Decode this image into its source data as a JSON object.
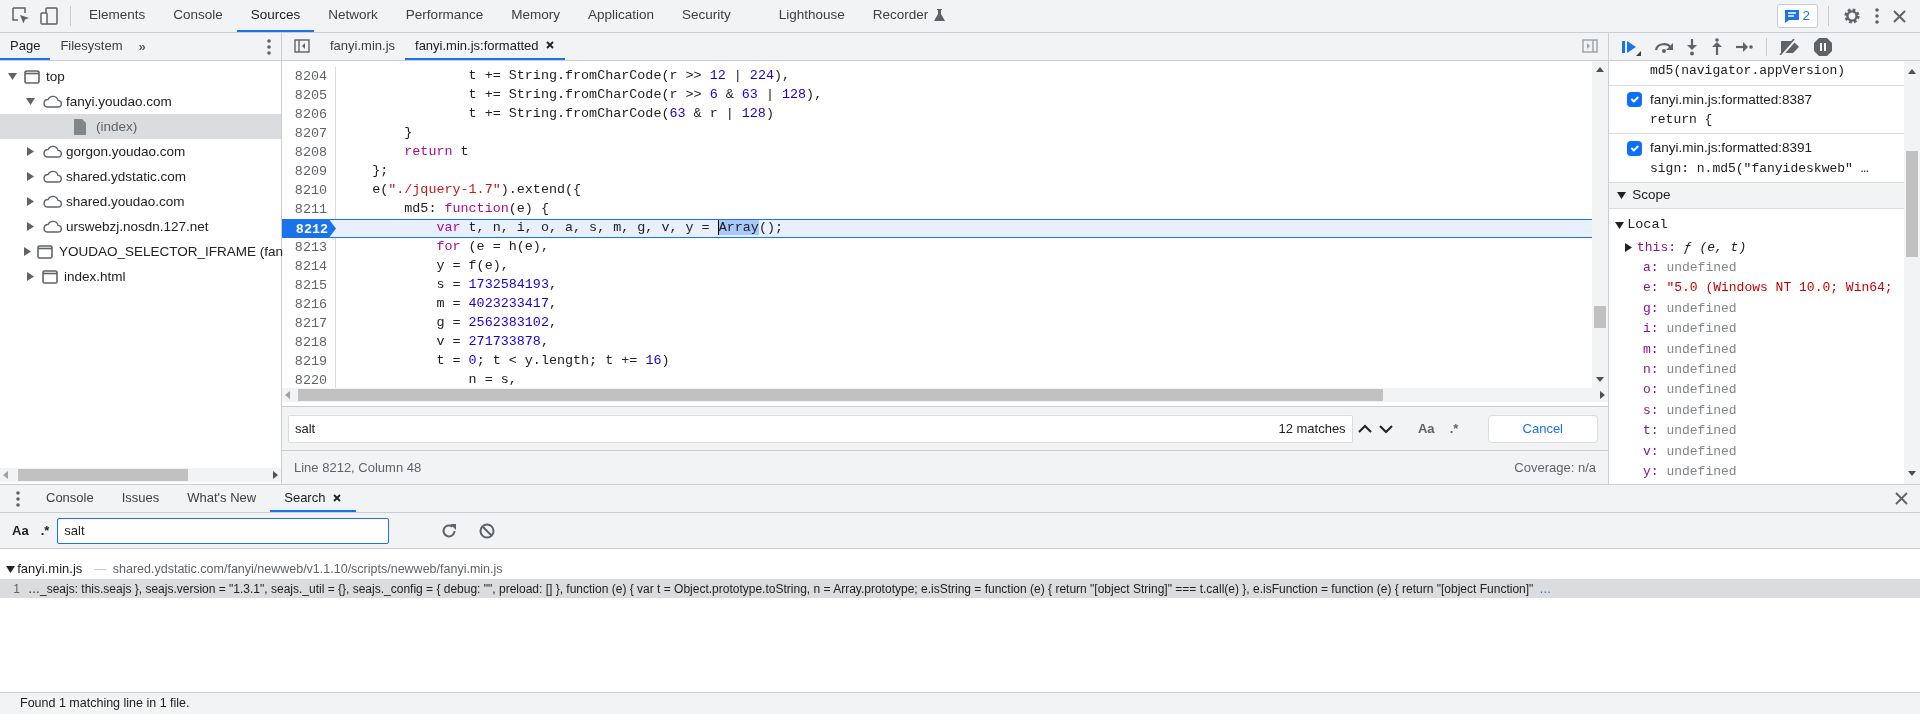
{
  "toolbar": {
    "tabs": [
      {
        "label": "Elements",
        "selected": false,
        "experimental": false
      },
      {
        "label": "Console",
        "selected": false,
        "experimental": false
      },
      {
        "label": "Sources",
        "selected": true,
        "experimental": false
      },
      {
        "label": "Network",
        "selected": false,
        "experimental": false
      },
      {
        "label": "Performance",
        "selected": false,
        "experimental": false
      },
      {
        "label": "Memory",
        "selected": false,
        "experimental": false
      },
      {
        "label": "Application",
        "selected": false,
        "experimental": false
      },
      {
        "label": "Security",
        "selected": false,
        "experimental": false
      },
      {
        "label": "Lighthouse",
        "selected": false,
        "experimental": false
      },
      {
        "label": "Recorder",
        "selected": false,
        "experimental": true
      }
    ],
    "issues_count": "2"
  },
  "navigator": {
    "tabs": [
      {
        "label": "Page",
        "selected": true
      },
      {
        "label": "Filesystem",
        "selected": false
      }
    ],
    "more": "»",
    "tree": [
      {
        "label": "top",
        "kind": "frame",
        "expanded": true,
        "selected": false,
        "children": [
          {
            "label": "fanyi.youdao.com",
            "kind": "domain",
            "expanded": true,
            "selected": false,
            "children": [
              {
                "label": "(index)",
                "kind": "file",
                "selected": true
              }
            ]
          },
          {
            "label": "gorgon.youdao.com",
            "kind": "domain",
            "expanded": false,
            "selected": false
          },
          {
            "label": "shared.ydstatic.com",
            "kind": "domain",
            "expanded": false,
            "selected": false
          },
          {
            "label": "shared.youdao.com",
            "kind": "domain",
            "expanded": false,
            "selected": false
          },
          {
            "label": "urswebzj.nosdn.127.net",
            "kind": "domain",
            "expanded": false,
            "selected": false
          },
          {
            "label": "YOUDAO_SELECTOR_IFRAME (fan",
            "kind": "frame",
            "expanded": false,
            "selected": false
          },
          {
            "label": "index.html",
            "kind": "frame",
            "expanded": false,
            "selected": false
          }
        ]
      }
    ]
  },
  "editor": {
    "tabs": [
      {
        "label": "fanyi.min.js",
        "selected": false,
        "closable": false
      },
      {
        "label": "fanyi.min.js:formatted",
        "selected": true,
        "closable": true
      }
    ],
    "lines": [
      {
        "number": "8204",
        "current": false,
        "tokens": [
          {
            "kind": "plain",
            "text": "                t += String.fromCharCode(r >> "
          },
          {
            "kind": "num",
            "text": "12"
          },
          {
            "kind": "plain",
            "text": " | "
          },
          {
            "kind": "num",
            "text": "224"
          },
          {
            "kind": "plain",
            "text": "),"
          }
        ]
      },
      {
        "number": "8205",
        "current": false,
        "tokens": [
          {
            "kind": "plain",
            "text": "                t += String.fromCharCode(r >> "
          },
          {
            "kind": "num",
            "text": "6"
          },
          {
            "kind": "plain",
            "text": " & "
          },
          {
            "kind": "num",
            "text": "63"
          },
          {
            "kind": "plain",
            "text": " | "
          },
          {
            "kind": "num",
            "text": "128"
          },
          {
            "kind": "plain",
            "text": "),"
          }
        ]
      },
      {
        "number": "8206",
        "current": false,
        "tokens": [
          {
            "kind": "plain",
            "text": "                t += String.fromCharCode("
          },
          {
            "kind": "num",
            "text": "63"
          },
          {
            "kind": "plain",
            "text": " & r | "
          },
          {
            "kind": "num",
            "text": "128"
          },
          {
            "kind": "plain",
            "text": ")"
          }
        ]
      },
      {
        "number": "8207",
        "current": false,
        "tokens": [
          {
            "kind": "plain",
            "text": "        }"
          }
        ]
      },
      {
        "number": "8208",
        "current": false,
        "tokens": [
          {
            "kind": "kw",
            "text": "        return"
          },
          {
            "kind": "plain",
            "text": " t"
          }
        ]
      },
      {
        "number": "8209",
        "current": false,
        "tokens": [
          {
            "kind": "plain",
            "text": "    };"
          }
        ]
      },
      {
        "number": "8210",
        "current": false,
        "tokens": [
          {
            "kind": "plain",
            "text": "    e("
          },
          {
            "kind": "str",
            "text": "\"./jquery-1.7\""
          },
          {
            "kind": "plain",
            "text": ").extend({"
          }
        ]
      },
      {
        "number": "8211",
        "current": false,
        "tokens": [
          {
            "kind": "plain",
            "text": "        md5: "
          },
          {
            "kind": "kw",
            "text": "function"
          },
          {
            "kind": "plain",
            "text": "(e) {"
          }
        ]
      },
      {
        "number": "8212",
        "current": true,
        "tokens": [
          {
            "kind": "kw",
            "text": "            var"
          },
          {
            "kind": "plain",
            "text": " t, n, i, o, a, s, m, g, v, y = "
          },
          {
            "kind": "sel",
            "text": "Array"
          },
          {
            "kind": "plain",
            "text": "();"
          }
        ]
      },
      {
        "number": "8213",
        "current": false,
        "tokens": [
          {
            "kind": "kw",
            "text": "            for"
          },
          {
            "kind": "plain",
            "text": " (e = h(e),"
          }
        ]
      },
      {
        "number": "8214",
        "current": false,
        "tokens": [
          {
            "kind": "plain",
            "text": "            y = f(e),"
          }
        ]
      },
      {
        "number": "8215",
        "current": false,
        "tokens": [
          {
            "kind": "plain",
            "text": "            s = "
          },
          {
            "kind": "num",
            "text": "1732584193"
          },
          {
            "kind": "plain",
            "text": ","
          }
        ]
      },
      {
        "number": "8216",
        "current": false,
        "tokens": [
          {
            "kind": "plain",
            "text": "            m = "
          },
          {
            "kind": "num",
            "text": "4023233417"
          },
          {
            "kind": "plain",
            "text": ","
          }
        ]
      },
      {
        "number": "8217",
        "current": false,
        "tokens": [
          {
            "kind": "plain",
            "text": "            g = "
          },
          {
            "kind": "num",
            "text": "2562383102"
          },
          {
            "kind": "plain",
            "text": ","
          }
        ]
      },
      {
        "number": "8218",
        "current": false,
        "tokens": [
          {
            "kind": "plain",
            "text": "            v = "
          },
          {
            "kind": "num",
            "text": "271733878"
          },
          {
            "kind": "plain",
            "text": ","
          }
        ]
      },
      {
        "number": "8219",
        "current": false,
        "tokens": [
          {
            "kind": "plain",
            "text": "            t = "
          },
          {
            "kind": "num",
            "text": "0"
          },
          {
            "kind": "plain",
            "text": "; t < y.length; t += "
          },
          {
            "kind": "num",
            "text": "16"
          },
          {
            "kind": "plain",
            "text": ")"
          }
        ]
      },
      {
        "number": "8220",
        "current": false,
        "tokens": [
          {
            "kind": "plain",
            "text": "                n = s,"
          }
        ]
      }
    ],
    "find": {
      "query": "salt",
      "matches": "12 matches",
      "case_label": "Aa",
      "regex_label": ".*",
      "cancel": "Cancel"
    },
    "status": {
      "position": "Line 8212, Column 48",
      "coverage": "Coverage: n/a"
    }
  },
  "debugger": {
    "breakpoints": [
      {
        "code": "md5(navigator.appVersion)"
      },
      {
        "location": "fanyi.min.js:formatted:8387",
        "code": "return {",
        "checked": true
      },
      {
        "location": "fanyi.min.js:formatted:8391",
        "code": "sign: n.md5(\"fanyideskweb\" …",
        "checked": true
      }
    ],
    "scope": {
      "title": "Scope",
      "expanded": true,
      "sections": [
        {
          "title": "Local",
          "expanded": true,
          "vars": [
            {
              "name": "this:",
              "kind": "function",
              "value": "ƒ (e, t)"
            },
            {
              "name": "a:",
              "kind": "undefined",
              "value": "undefined"
            },
            {
              "name": "e:",
              "kind": "string",
              "value": "\"5.0 (Windows NT 10.0; Win64;"
            },
            {
              "name": "g:",
              "kind": "undefined",
              "value": "undefined"
            },
            {
              "name": "i:",
              "kind": "undefined",
              "value": "undefined"
            },
            {
              "name": "m:",
              "kind": "undefined",
              "value": "undefined"
            },
            {
              "name": "n:",
              "kind": "undefined",
              "value": "undefined"
            },
            {
              "name": "o:",
              "kind": "undefined",
              "value": "undefined"
            },
            {
              "name": "s:",
              "kind": "undefined",
              "value": "undefined"
            },
            {
              "name": "t:",
              "kind": "undefined",
              "value": "undefined"
            },
            {
              "name": "v:",
              "kind": "undefined",
              "value": "undefined"
            },
            {
              "name": "y:",
              "kind": "undefined",
              "value": "undefined"
            }
          ]
        }
      ]
    }
  },
  "drawer": {
    "tabs": [
      {
        "label": "Console",
        "selected": false,
        "closable": false
      },
      {
        "label": "Issues",
        "selected": false,
        "closable": false
      },
      {
        "label": "What's New",
        "selected": false,
        "closable": false
      },
      {
        "label": "Search",
        "selected": true,
        "closable": true
      }
    ],
    "search": {
      "case_label": "Aa",
      "regex_label": ".*",
      "query": "salt"
    },
    "results": [
      {
        "file": "fanyi.min.js",
        "separator": "—",
        "path": "shared.ydstatic.com/fanyi/newweb/v1.1.10/scripts/newweb/fanyi.min.js",
        "expanded": true,
        "matches": [
          {
            "line": "1",
            "selected": true,
            "text": "…_seajs: this.seajs }, seajs.version = \"1.3.1\", seajs._util = {}, seajs._config = { debug: \"\", preload: [] }, function (e) { var t = Object.prototype.toString, n = Array.prototype; e.isString = function (e) { return \"[object String]\" === t.call(e) }, e.isFunction = function (e) { return \"[object Function]\"",
            "more": "…"
          }
        ]
      }
    ],
    "summary": "Found 1 matching line in 1 file."
  }
}
